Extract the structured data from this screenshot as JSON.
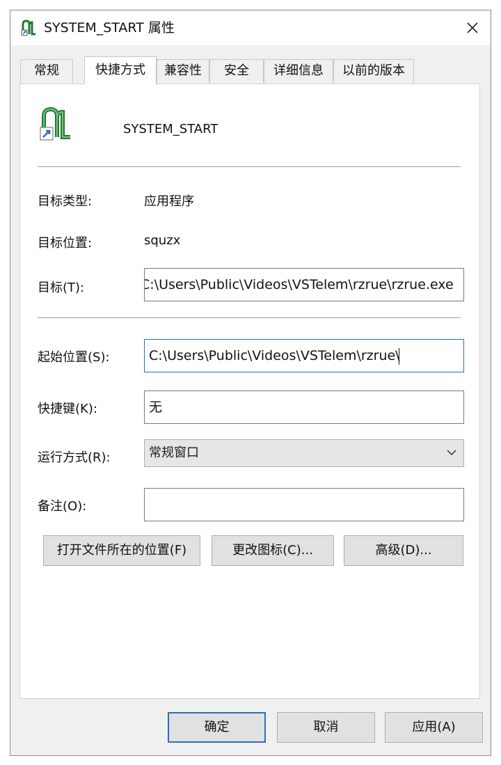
{
  "window": {
    "title": "SYSTEM_START 属性",
    "close_glyph": "✕"
  },
  "tabs": [
    {
      "label": "常规"
    },
    {
      "label": "快捷方式",
      "active": true
    },
    {
      "label": "兼容性"
    },
    {
      "label": "安全"
    },
    {
      "label": "详细信息"
    },
    {
      "label": "以前的版本"
    }
  ],
  "shortcut": {
    "name": "SYSTEM_START",
    "target_type_label": "目标类型:",
    "target_type_value": "应用程序",
    "target_location_label": "目标位置:",
    "target_location_value": "squzx",
    "target_label": "目标(T):",
    "target_value": "C:\\Users\\Public\\Videos\\VSTelem\\rzrue\\rzrue.exe",
    "start_in_label": "起始位置(S):",
    "start_in_value": "C:\\Users\\Public\\Videos\\VSTelem\\rzrue\\",
    "hotkey_label": "快捷键(K):",
    "hotkey_value": "无",
    "run_label": "运行方式(R):",
    "run_value": "常规窗口",
    "comment_label": "备注(O):",
    "comment_value": ""
  },
  "buttons": {
    "open_location": "打开文件所在的位置(F)",
    "change_icon": "更改图标(C)...",
    "advanced": "高级(D)...",
    "ok": "确定",
    "cancel": "取消",
    "apply": "应用(A)"
  },
  "icons": {
    "app": "application-shortcut-icon",
    "close": "close-icon",
    "dropdown": "chevron-down-icon"
  },
  "colors": {
    "icon_green": "#1f7a2e",
    "focus_blue": "#2a6fb8"
  }
}
